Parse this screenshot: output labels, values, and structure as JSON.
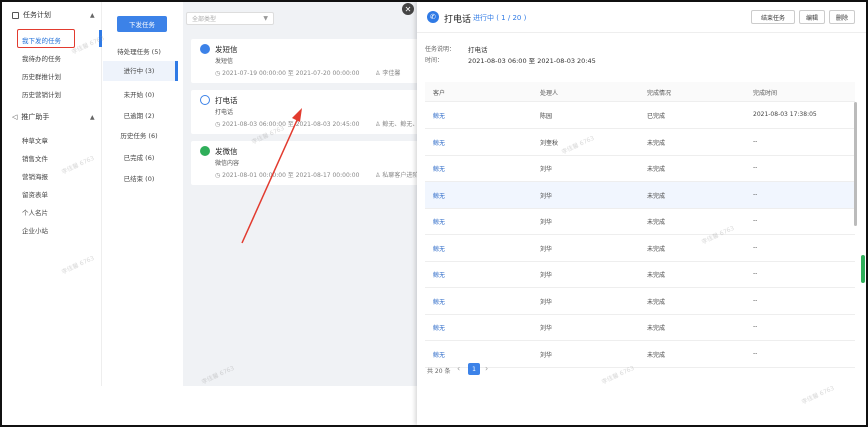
{
  "sidebar": {
    "group1": {
      "label": "任务计划",
      "caret": "▲"
    },
    "items1": [
      "我下发的任务",
      "我待办的任务",
      "历史群推计划",
      "历史营销计划"
    ],
    "group2": {
      "label": "推广助手",
      "caret": "▲"
    },
    "items2": [
      "种草文章",
      "销售文件",
      "营销海报",
      "留资表单",
      "个人名片",
      "企业小站"
    ]
  },
  "status": {
    "issue_button": "下发任务",
    "items": [
      "待处理任务 (5)",
      "进行中 (3)",
      "未开始 (0)",
      "已逾期 (2)",
      "历史任务 (6)",
      "已完成 (6)",
      "已结束 (0)"
    ]
  },
  "middle": {
    "type_placeholder": "全部类型",
    "cards": [
      {
        "title": "发短信",
        "desc": "发短信",
        "time": "2021-07-19 00:00:00 至 2021-07-20 00:00:00",
        "who": "李佳馨",
        "color": "#3c82e8"
      },
      {
        "title": "打电话",
        "desc": "打电话",
        "time": "2021-08-03 06:00:00 至 2021-08-03 20:45:00",
        "who": "鲸无、鲸无、",
        "color": "#3c82e8"
      },
      {
        "title": "发微信",
        "desc": "微信内容",
        "time": "2021-08-01 00:00:00 至 2021-08-17 00:00:00",
        "who": "私聊客户进阶",
        "color": "#2fae5a"
      }
    ]
  },
  "drawer": {
    "title": "打电话",
    "status": "进行中 ( 1 / 20 )",
    "buttons": {
      "end": "结束任务",
      "edit": "编辑",
      "delete": "删除"
    },
    "desc_label": "任务说明：",
    "desc_value": "打电话",
    "time_label": "时间：",
    "time_value": "2021-08-03 06:00 至 2021-08-03 20:45",
    "columns": [
      "客户",
      "处理人",
      "完成情况",
      "完成时间"
    ],
    "rows": [
      [
        "鲸无",
        "陈园",
        "已完成",
        "2021-08-03 17:38:05"
      ],
      [
        "鲸无",
        "刘奎秋",
        "未完成",
        "--"
      ],
      [
        "鲸无",
        "刘华",
        "未完成",
        "--"
      ],
      [
        "鲸无",
        "刘华",
        "未完成",
        "--"
      ],
      [
        "鲸无",
        "刘华",
        "未完成",
        "--"
      ],
      [
        "鲸无",
        "刘华",
        "未完成",
        "--"
      ],
      [
        "鲸无",
        "刘华",
        "未完成",
        "--"
      ],
      [
        "鲸无",
        "刘华",
        "未完成",
        "--"
      ],
      [
        "鲸无",
        "刘华",
        "未完成",
        "--"
      ],
      [
        "鲸无",
        "刘华",
        "未完成",
        "--"
      ]
    ],
    "pager": {
      "total": "共 20 条",
      "current": "1",
      "prev": "‹",
      "next": "›"
    }
  },
  "watermark": "李佳馨 6763",
  "close": "✕"
}
